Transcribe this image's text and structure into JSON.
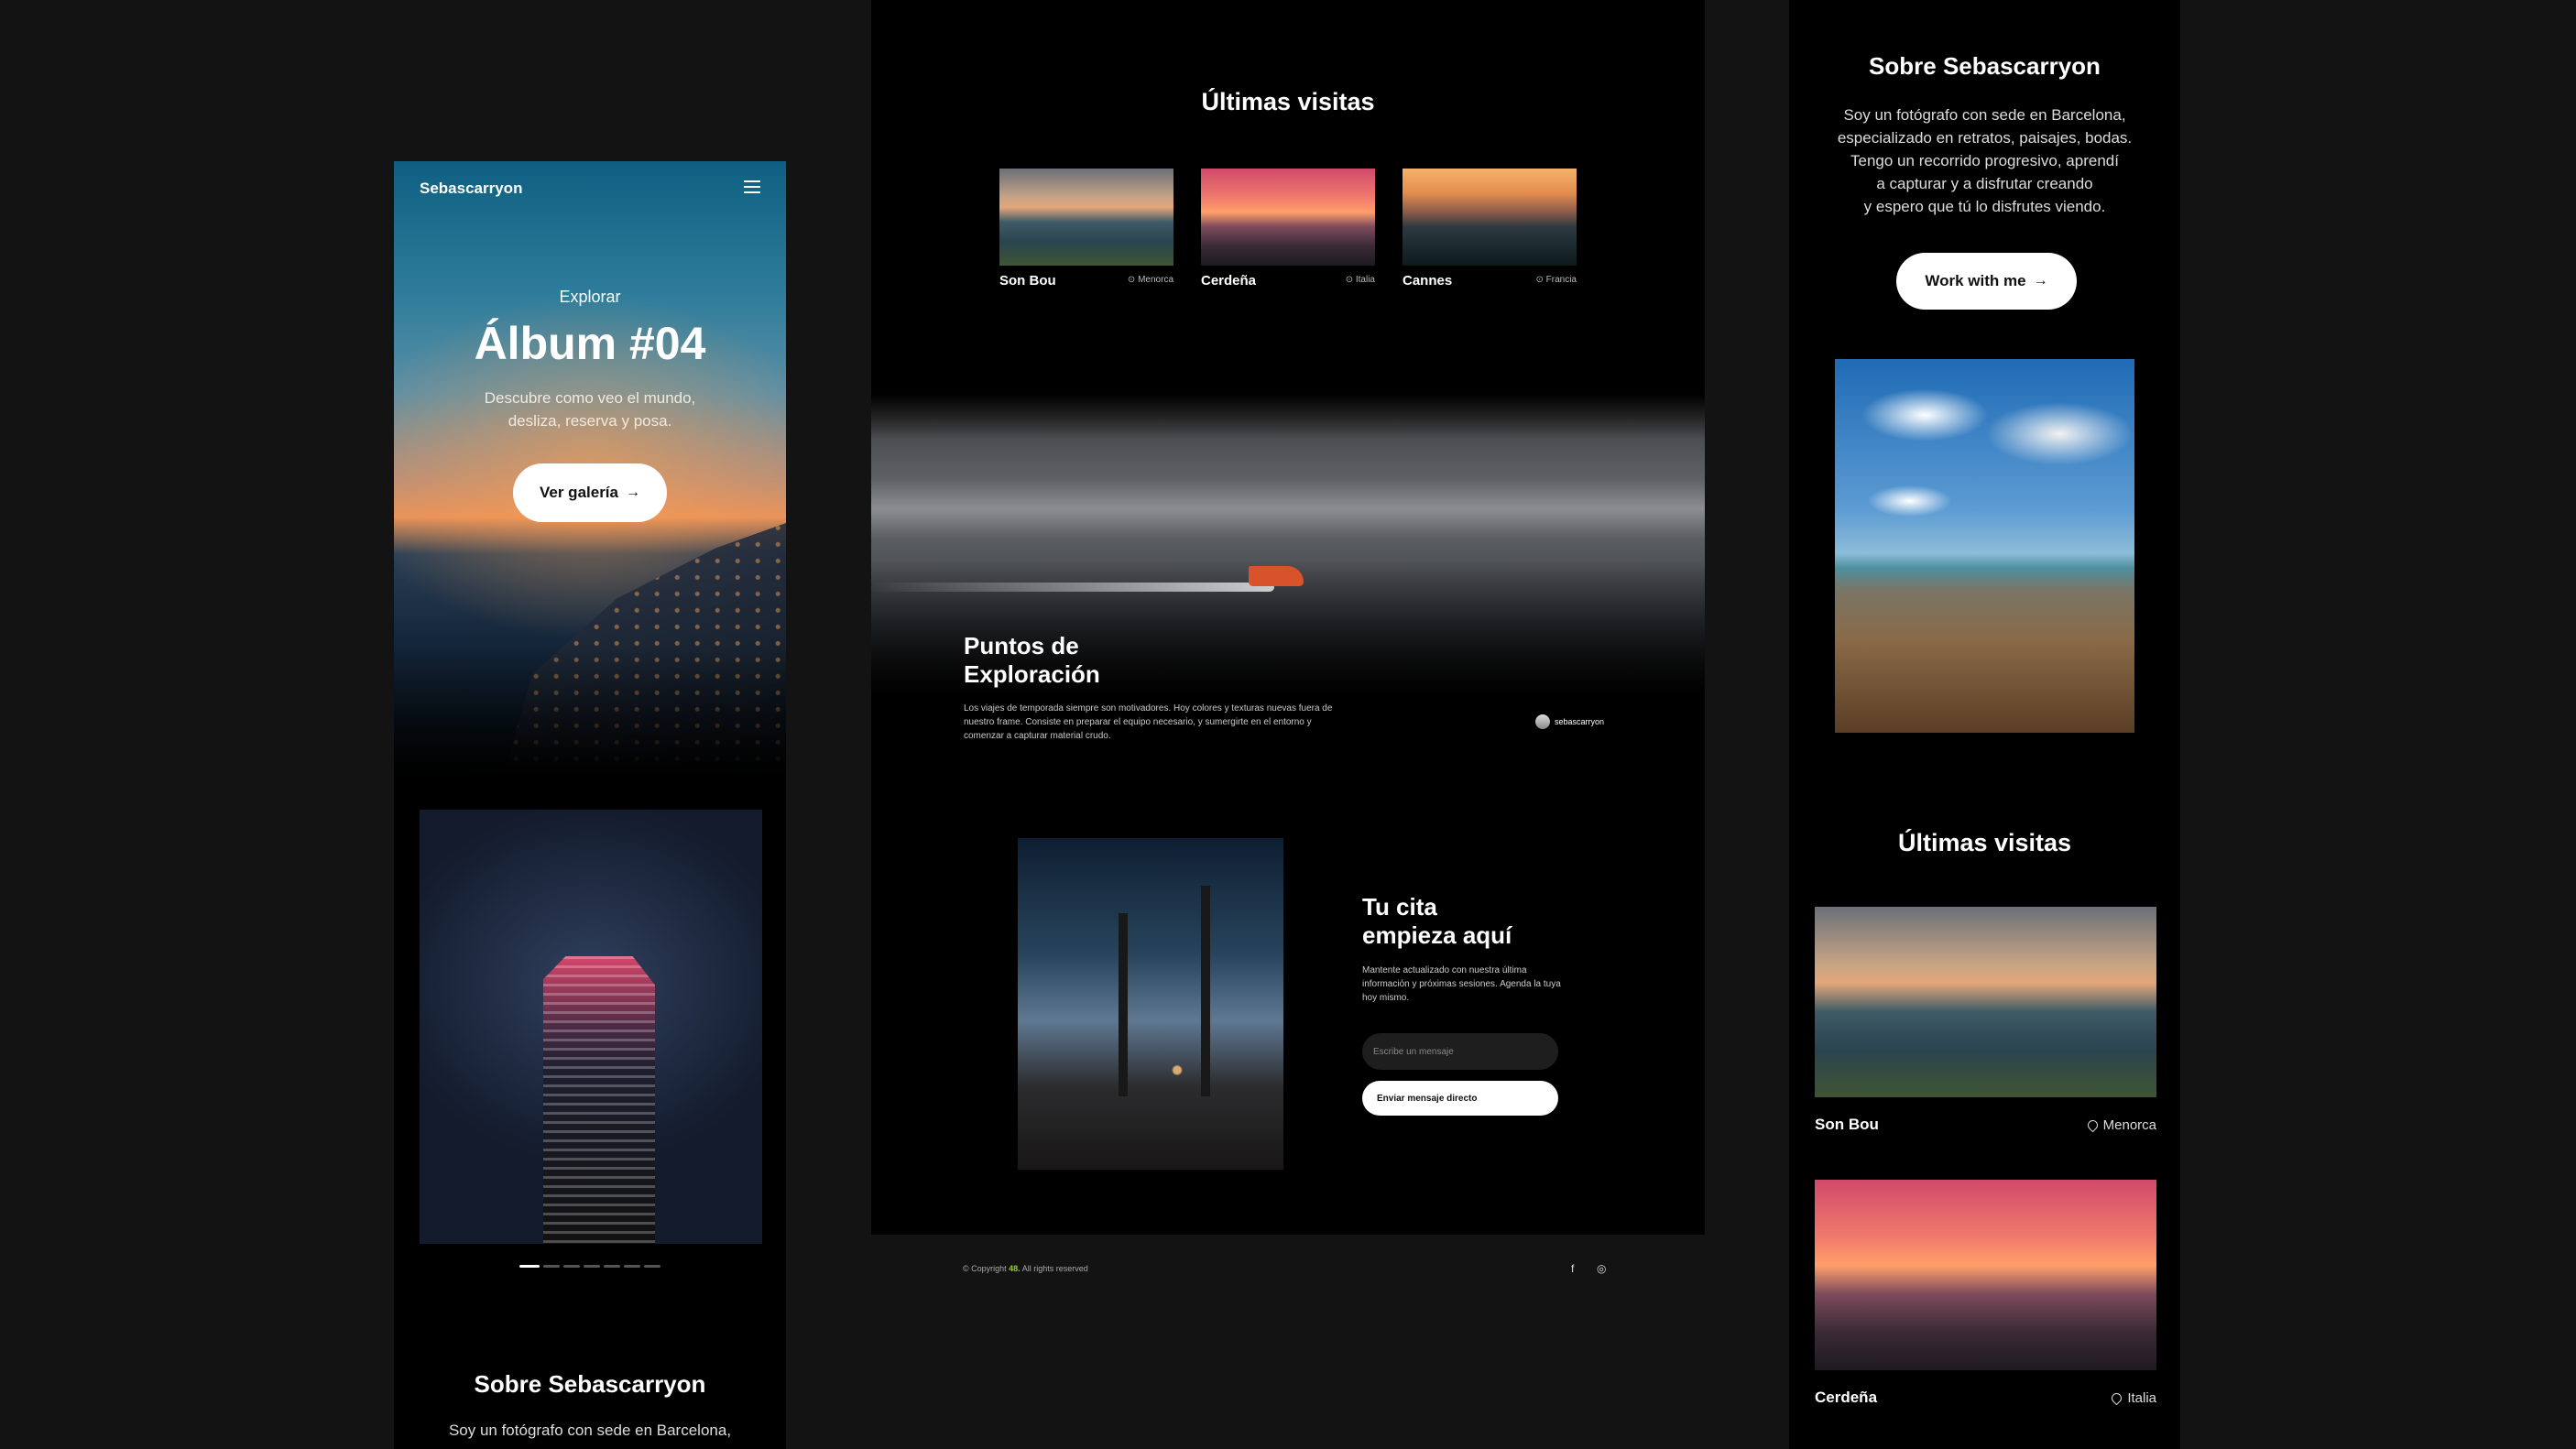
{
  "left_panel": {
    "brand": "Sebascarryon",
    "hero": {
      "kicker": "Explorar",
      "title": "Álbum #04",
      "subtitle_line1": "Descubre como veo el mundo,",
      "subtitle_line2": "desliza, reserva y posa.",
      "button_label": "Ver galería"
    },
    "carousel": {
      "slides": 7,
      "active": 1
    },
    "about": {
      "title": "Sobre Sebascarryon",
      "text": "Soy un fotógrafo con sede en Barcelona,"
    }
  },
  "center_panel": {
    "visits_title": "Últimas visitas",
    "cards": [
      {
        "name": "Son Bou",
        "location": "Menorca"
      },
      {
        "name": "Cerdeña",
        "location": "Italia"
      },
      {
        "name": "Cannes",
        "location": "Francia"
      }
    ],
    "banner": {
      "title_line1": "Puntos de",
      "title_line2": "Exploración",
      "text": "Los viajes de temporada siempre son motivadores. Hoy colores y texturas nuevas fuera de nuestro frame. Consiste en preparar el equipo necesario, y sumergirte en el entorno y comenzar a capturar material crudo.",
      "author": "sebascarryon"
    },
    "cita": {
      "title_line1": "Tu cita",
      "title_line2": "empieza aquí",
      "text": "Mantente actualizado con nuestra última información y próximas sesiones. Agenda la tuya hoy mismo.",
      "input_placeholder": "Escribe un mensaje",
      "button_label": "Enviar mensaje directo"
    },
    "footer": {
      "copyright_prefix": "© Copyright",
      "copyright_brand": "48.",
      "copyright_suffix": "All rights reserved",
      "facebook": "f",
      "instagram": "◎"
    }
  },
  "right_panel": {
    "about": {
      "title": "Sobre Sebascarryon",
      "line1": "Soy un fotógrafo con sede en Barcelona,",
      "line2": "especializado en retratos, paisajes, bodas.",
      "line3": "Tengo un recorrido progresivo, aprendí",
      "line4": "a capturar y a disfrutar creando",
      "line5": "y espero que tú lo disfrutes viendo.",
      "button_label": "Work with me"
    },
    "visits_title": "Últimas visitas",
    "cards": [
      {
        "name": "Son Bou",
        "location": "Menorca"
      },
      {
        "name": "Cerdeña",
        "location": "Italia"
      }
    ]
  },
  "icons": {
    "arrow": "→",
    "menu": "hamburger-icon",
    "pin": "location-pin-icon"
  }
}
